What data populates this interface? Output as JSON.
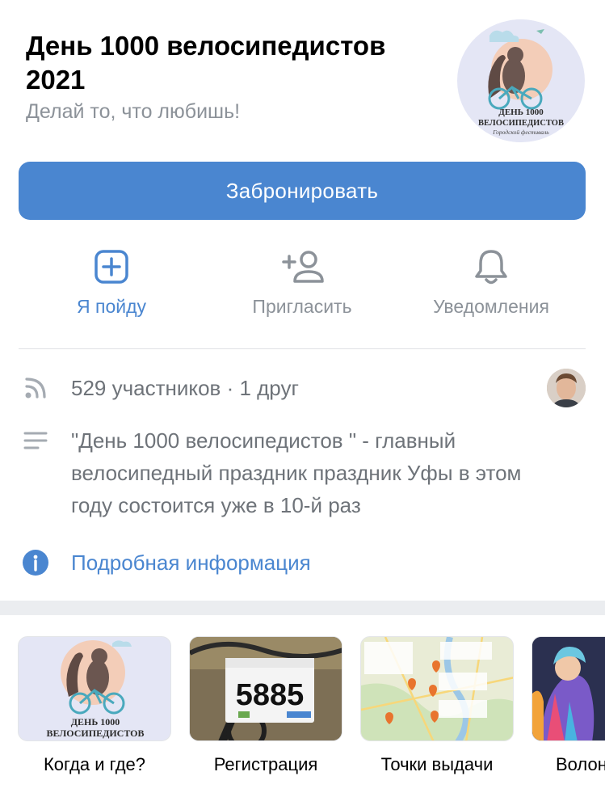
{
  "event": {
    "title": "День 1000 велосипедистов 2021",
    "subtitle": "Делай то, что любишь!",
    "logo_text_line1": "ДЕНЬ 1000",
    "logo_text_line2": "ВЕЛОСИПЕДИСТОВ",
    "logo_text_line3": "Городской фестиваль"
  },
  "book_button": {
    "label": "Забронировать"
  },
  "actions": [
    {
      "label": "Я пойду",
      "icon": "plus-square-icon"
    },
    {
      "label": "Пригласить",
      "icon": "add-person-icon"
    },
    {
      "label": "Уведомления",
      "icon": "bell-icon"
    }
  ],
  "info": {
    "members": "529 участников · 1 друг",
    "description": "\"День 1000 велосипедистов \" - главный велосипедный праздник праздник Уфы в этом году состоится уже в 10-й раз",
    "more_link": "Подробная информация"
  },
  "cards": [
    {
      "label": "Когда и где?",
      "thumb_line1": "ДЕНЬ 1000",
      "thumb_line2": "ВЕЛОСИПЕДИСТОВ"
    },
    {
      "label": "Регистрация",
      "thumb_number": "5885"
    },
    {
      "label": "Точки выдачи"
    },
    {
      "label": "Волон"
    }
  ],
  "colors": {
    "accent": "#4a86d0",
    "secondary_text": "#8c9299",
    "divider": "#dfe1e5"
  }
}
